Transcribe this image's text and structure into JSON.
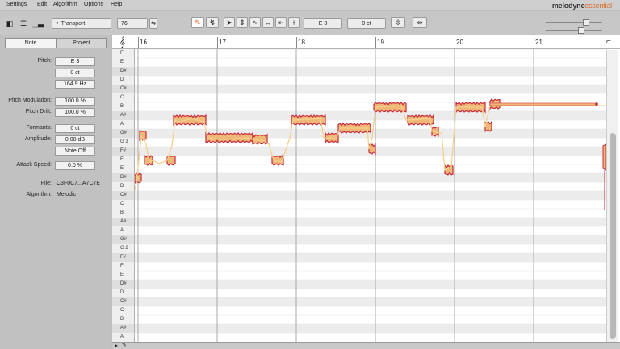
{
  "menu": {
    "items": [
      {
        "name": "menu-settings",
        "label": "Settings"
      },
      {
        "name": "menu-edit",
        "label": "Edit"
      },
      {
        "name": "menu-algorithm",
        "label": "Algorithm"
      },
      {
        "name": "menu-options",
        "label": "Options"
      },
      {
        "name": "menu-help",
        "label": "Help"
      }
    ],
    "logo_main": "melodyne",
    "logo_accent": "essential"
  },
  "toolbar": {
    "transport_label": "Transport",
    "tempo_value": "76",
    "pitch_note": "E 3",
    "pitch_cents": "0 ct"
  },
  "inspector": {
    "tabs": [
      "Note",
      "Project"
    ],
    "pitch_label": "Pitch:",
    "pitch_note": "E 3",
    "pitch_cents": "0 ct",
    "pitch_hz": "164.9 Hz",
    "pitch_modulation_label": "Pitch Modulation:",
    "pitch_modulation_value": "100.0 %",
    "pitch_drift_label": "Pitch Drift:",
    "pitch_drift_value": "100.0 %",
    "formants_label": "Formants:",
    "formants_value": "0 ct",
    "amplitude_label": "Amplitude:",
    "amplitude_value": "0.00 dB",
    "note_off_label": "Note Off",
    "attack_speed_label": "Attack Speed:",
    "attack_speed_value": "0.0 %",
    "file_label": "File:",
    "file_value": "C3F0C7...A7C7E",
    "algorithm_label": "Algorithm:",
    "algorithm_value": "Melodic"
  },
  "ruler": {
    "bars": [
      "16",
      "17",
      "18",
      "19",
      "20",
      "21"
    ]
  },
  "piano_keys": [
    {
      "label": "F",
      "black": false
    },
    {
      "label": "E",
      "black": false
    },
    {
      "label": "D#",
      "black": true
    },
    {
      "label": "D",
      "black": false
    },
    {
      "label": "C#",
      "black": true
    },
    {
      "label": "C",
      "black": false
    },
    {
      "label": "B",
      "black": false
    },
    {
      "label": "A#",
      "black": true
    },
    {
      "label": "A",
      "black": false
    },
    {
      "label": "G#",
      "black": true
    },
    {
      "label": "G 3",
      "black": false
    },
    {
      "label": "F#",
      "black": true
    },
    {
      "label": "F",
      "black": false
    },
    {
      "label": "E",
      "black": false
    },
    {
      "label": "D#",
      "black": true
    },
    {
      "label": "D",
      "black": false
    },
    {
      "label": "C#",
      "black": true
    },
    {
      "label": "C",
      "black": false
    },
    {
      "label": "B",
      "black": false
    },
    {
      "label": "A#",
      "black": true
    },
    {
      "label": "A",
      "black": false
    },
    {
      "label": "G#",
      "black": true
    },
    {
      "label": "G 2",
      "black": false
    },
    {
      "label": "F#",
      "black": true
    },
    {
      "label": "F",
      "black": false
    },
    {
      "label": "E",
      "black": false
    },
    {
      "label": "D#",
      "black": true
    },
    {
      "label": "D",
      "black": false
    },
    {
      "label": "C#",
      "black": true
    },
    {
      "label": "C",
      "black": false
    },
    {
      "label": "B",
      "black": false
    },
    {
      "label": "A#",
      "black": true
    },
    {
      "label": "A",
      "black": false
    }
  ],
  "colors": {
    "blob_fill": "#f0b877",
    "blob_edge": "#c8283a",
    "pitch_line": "#f6cf8f",
    "accent": "#d86a2c"
  }
}
